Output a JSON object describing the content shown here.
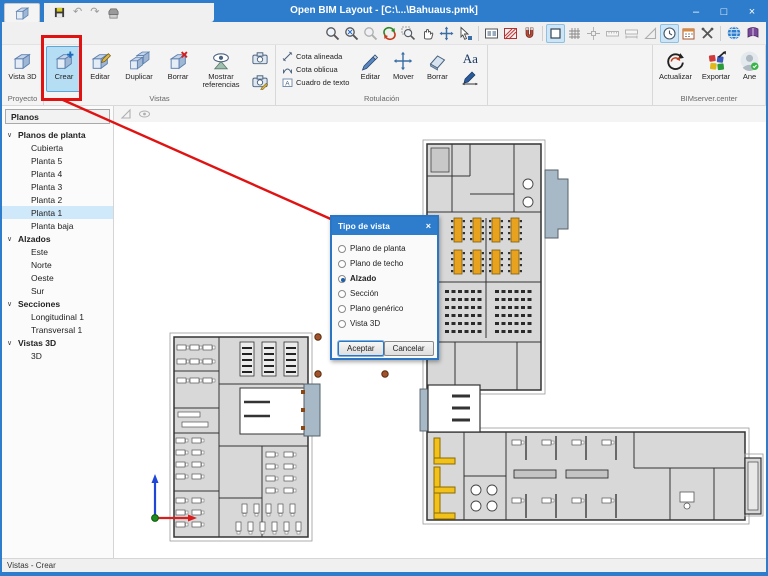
{
  "window": {
    "title": "Open BIM Layout - [C:\\...\\Bahuaus.pmk]",
    "controls": {
      "minimize": "–",
      "maximize": "□",
      "close": "×"
    },
    "quick_access_icons": [
      "app-cube-icon",
      "save-icon",
      "undo-icon",
      "redo-icon",
      "printer-icon"
    ]
  },
  "view_toolbar": {
    "icons": [
      "zoom-window-icon",
      "zoom-extents-icon",
      "zoom-previous-icon",
      "orbit-icon",
      "zoom-region-icon",
      "pan-hand-icon",
      "move-view-icon",
      "pointer-select-icon",
      "slide-icon",
      "hatch-icon",
      "magnet-snap-icon",
      "rectangle-icon",
      "grid-icon",
      "object-snap-icon",
      "dimension-ruler-icon",
      "dimension-ruler2-icon",
      "set-square-icon",
      "clock-icon",
      "calendar-icon",
      "tools-icon",
      "globe-icon",
      "help-book-icon"
    ]
  },
  "ribbon": {
    "groups": [
      {
        "label": "Proyecto",
        "buttons": [
          {
            "label": "Vista 3D",
            "icon": "cube-3d-icon"
          }
        ]
      },
      {
        "label": "Vistas",
        "buttons": [
          {
            "label": "Crear",
            "icon": "cube-plus-icon",
            "selected": true
          },
          {
            "label": "Editar",
            "icon": "cube-edit-icon"
          },
          {
            "label": "Duplicar",
            "icon": "cube-duplicate-icon"
          },
          {
            "label": "Borrar",
            "icon": "cube-delete-icon"
          },
          {
            "label": "Mostrar referencias",
            "icon": "eye-reference-icon"
          }
        ],
        "small_buttons": [
          {
            "icon": "camera-icon"
          },
          {
            "icon": "camera-edit-icon"
          }
        ]
      },
      {
        "label": "Rotulación",
        "checklist": [
          {
            "label": "Cota alineada",
            "icon": "dimension-aligned-icon"
          },
          {
            "label": "Cota oblicua",
            "icon": "dimension-oblique-icon"
          },
          {
            "label": "Cuadro de texto",
            "icon": "text-box-icon"
          }
        ],
        "buttons": [
          {
            "label": "Editar",
            "icon": "pencil-icon"
          },
          {
            "label": "Mover",
            "icon": "move-cross-icon"
          },
          {
            "label": "Borrar",
            "icon": "eraser-icon"
          }
        ],
        "stack": [
          {
            "icon": "text-style-icon",
            "glyph": "Aa"
          },
          {
            "icon": "pen-dimension-icon"
          }
        ]
      },
      {
        "label": "",
        "buttons": []
      },
      {
        "label": "BIMserver.center",
        "buttons": [
          {
            "label": "Actualizar",
            "icon": "sync-icon"
          },
          {
            "label": "Exportar",
            "icon": "export-icon"
          },
          {
            "label": "Ane",
            "icon": "user-avatar-icon"
          }
        ]
      }
    ]
  },
  "sidebar": {
    "header": "Planos",
    "items": [
      {
        "label": "Planos de planta",
        "type": "section"
      },
      {
        "label": "Cubierta",
        "type": "child"
      },
      {
        "label": "Planta 5",
        "type": "child"
      },
      {
        "label": "Planta 4",
        "type": "child"
      },
      {
        "label": "Planta 3",
        "type": "child"
      },
      {
        "label": "Planta 2",
        "type": "child"
      },
      {
        "label": "Planta 1",
        "type": "child",
        "selected": true
      },
      {
        "label": "Planta baja",
        "type": "child"
      },
      {
        "label": "Alzados",
        "type": "section"
      },
      {
        "label": "Este",
        "type": "child"
      },
      {
        "label": "Norte",
        "type": "child"
      },
      {
        "label": "Oeste",
        "type": "child"
      },
      {
        "label": "Sur",
        "type": "child"
      },
      {
        "label": "Secciones",
        "type": "section"
      },
      {
        "label": "Longitudinal 1",
        "type": "child"
      },
      {
        "label": "Transversal 1",
        "type": "child"
      },
      {
        "label": "Vistas 3D",
        "type": "section"
      },
      {
        "label": "3D",
        "type": "child"
      }
    ]
  },
  "canvas": {
    "corner_icons": [
      "set-square-icon",
      "eye-icon"
    ],
    "annotation": {
      "highlight_target": "crear-button",
      "color": "#e01212"
    },
    "view_point_markers": 3
  },
  "dialog": {
    "title": "Tipo de vista",
    "close": "×",
    "options": [
      {
        "label": "Plano de planta",
        "selected": false
      },
      {
        "label": "Plano de techo",
        "selected": false
      },
      {
        "label": "Alzado",
        "selected": true
      },
      {
        "label": "Sección",
        "selected": false
      },
      {
        "label": "Plano genérico",
        "selected": false
      },
      {
        "label": "Vista 3D",
        "selected": false
      }
    ],
    "buttons": {
      "ok": "Aceptar",
      "cancel": "Cancelar"
    }
  },
  "statusbar": {
    "text": "Vistas - Crear"
  },
  "colors": {
    "titlebar": "#2e7dcc",
    "selection": "#b5ddf4",
    "tree_selection": "#cfe8fa",
    "annotation_red": "#e01212",
    "plan_fill": "#d8d8d8",
    "table_orange": "#e8a21d",
    "couch_yellow": "#f2c21a",
    "balcony_blue": "#a7b8c6"
  }
}
